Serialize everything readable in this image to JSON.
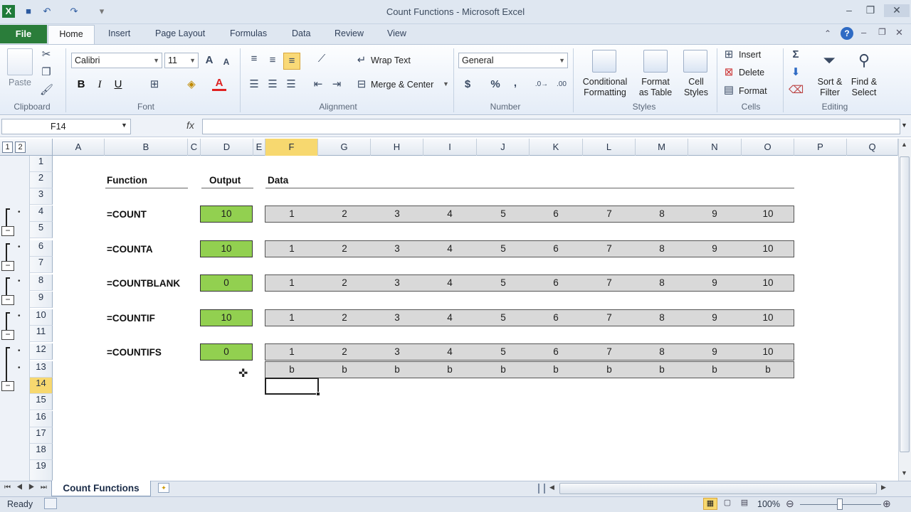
{
  "window": {
    "title": "Count Functions  -  Microsoft Excel"
  },
  "ribbon_tabs": [
    "File",
    "Home",
    "Insert",
    "Page Layout",
    "Formulas",
    "Data",
    "Review",
    "View"
  ],
  "ribbon": {
    "clipboard": {
      "paste": "Paste",
      "group": "Clipboard"
    },
    "font": {
      "name": "Calibri",
      "size": "11",
      "bold": "B",
      "italic": "I",
      "underline": "U",
      "group": "Font"
    },
    "alignment": {
      "wrap": "Wrap Text",
      "merge": "Merge & Center",
      "group": "Alignment"
    },
    "number": {
      "format": "General",
      "currency": "$",
      "percent": "%",
      "comma": ",",
      "group": "Number"
    },
    "styles": {
      "conditional1": "Conditional",
      "conditional2": "Formatting",
      "format1": "Format",
      "format2": "as Table",
      "cell1": "Cell",
      "cell2": "Styles",
      "group": "Styles"
    },
    "cells": {
      "insert": "Insert",
      "delete": "Delete",
      "format": "Format",
      "group": "Cells"
    },
    "editing": {
      "sigma": "Σ",
      "sort1": "Sort &",
      "sort2": "Filter",
      "find1": "Find &",
      "find2": "Select",
      "group": "Editing"
    }
  },
  "formula_bar": {
    "name_box": "F14",
    "fx": "fx",
    "formula": ""
  },
  "outline_levels": [
    "1",
    "2"
  ],
  "columns": [
    "A",
    "B",
    "C",
    "D",
    "E",
    "F",
    "G",
    "H",
    "I",
    "J",
    "K",
    "L",
    "M",
    "N",
    "O",
    "P",
    "Q"
  ],
  "rows": [
    "1",
    "2",
    "3",
    "4",
    "5",
    "6",
    "7",
    "8",
    "9",
    "10",
    "11",
    "12",
    "13",
    "14",
    "15",
    "16",
    "17",
    "18",
    "19"
  ],
  "headers": {
    "function": "Function",
    "output": "Output",
    "data": "Data"
  },
  "functions": [
    {
      "name": "=COUNT",
      "output": "10"
    },
    {
      "name": "=COUNTA",
      "output": "10"
    },
    {
      "name": "=COUNTBLANK",
      "output": "0"
    },
    {
      "name": "=COUNTIF",
      "output": "10"
    },
    {
      "name": "=COUNTIFS",
      "output": "0"
    }
  ],
  "data_values": [
    "1",
    "2",
    "3",
    "4",
    "5",
    "6",
    "7",
    "8",
    "9",
    "10"
  ],
  "data_letters": [
    "b",
    "b",
    "b",
    "b",
    "b",
    "b",
    "b",
    "b",
    "b",
    "b"
  ],
  "colors": {
    "output_fill": "#92d050",
    "data_fill": "#d9d9d9",
    "selected_header": "#f7d86f",
    "file_tab": "#2a7d3a"
  },
  "sheet_tab": "Count Functions",
  "status": {
    "ready": "Ready",
    "zoom": "100%"
  }
}
